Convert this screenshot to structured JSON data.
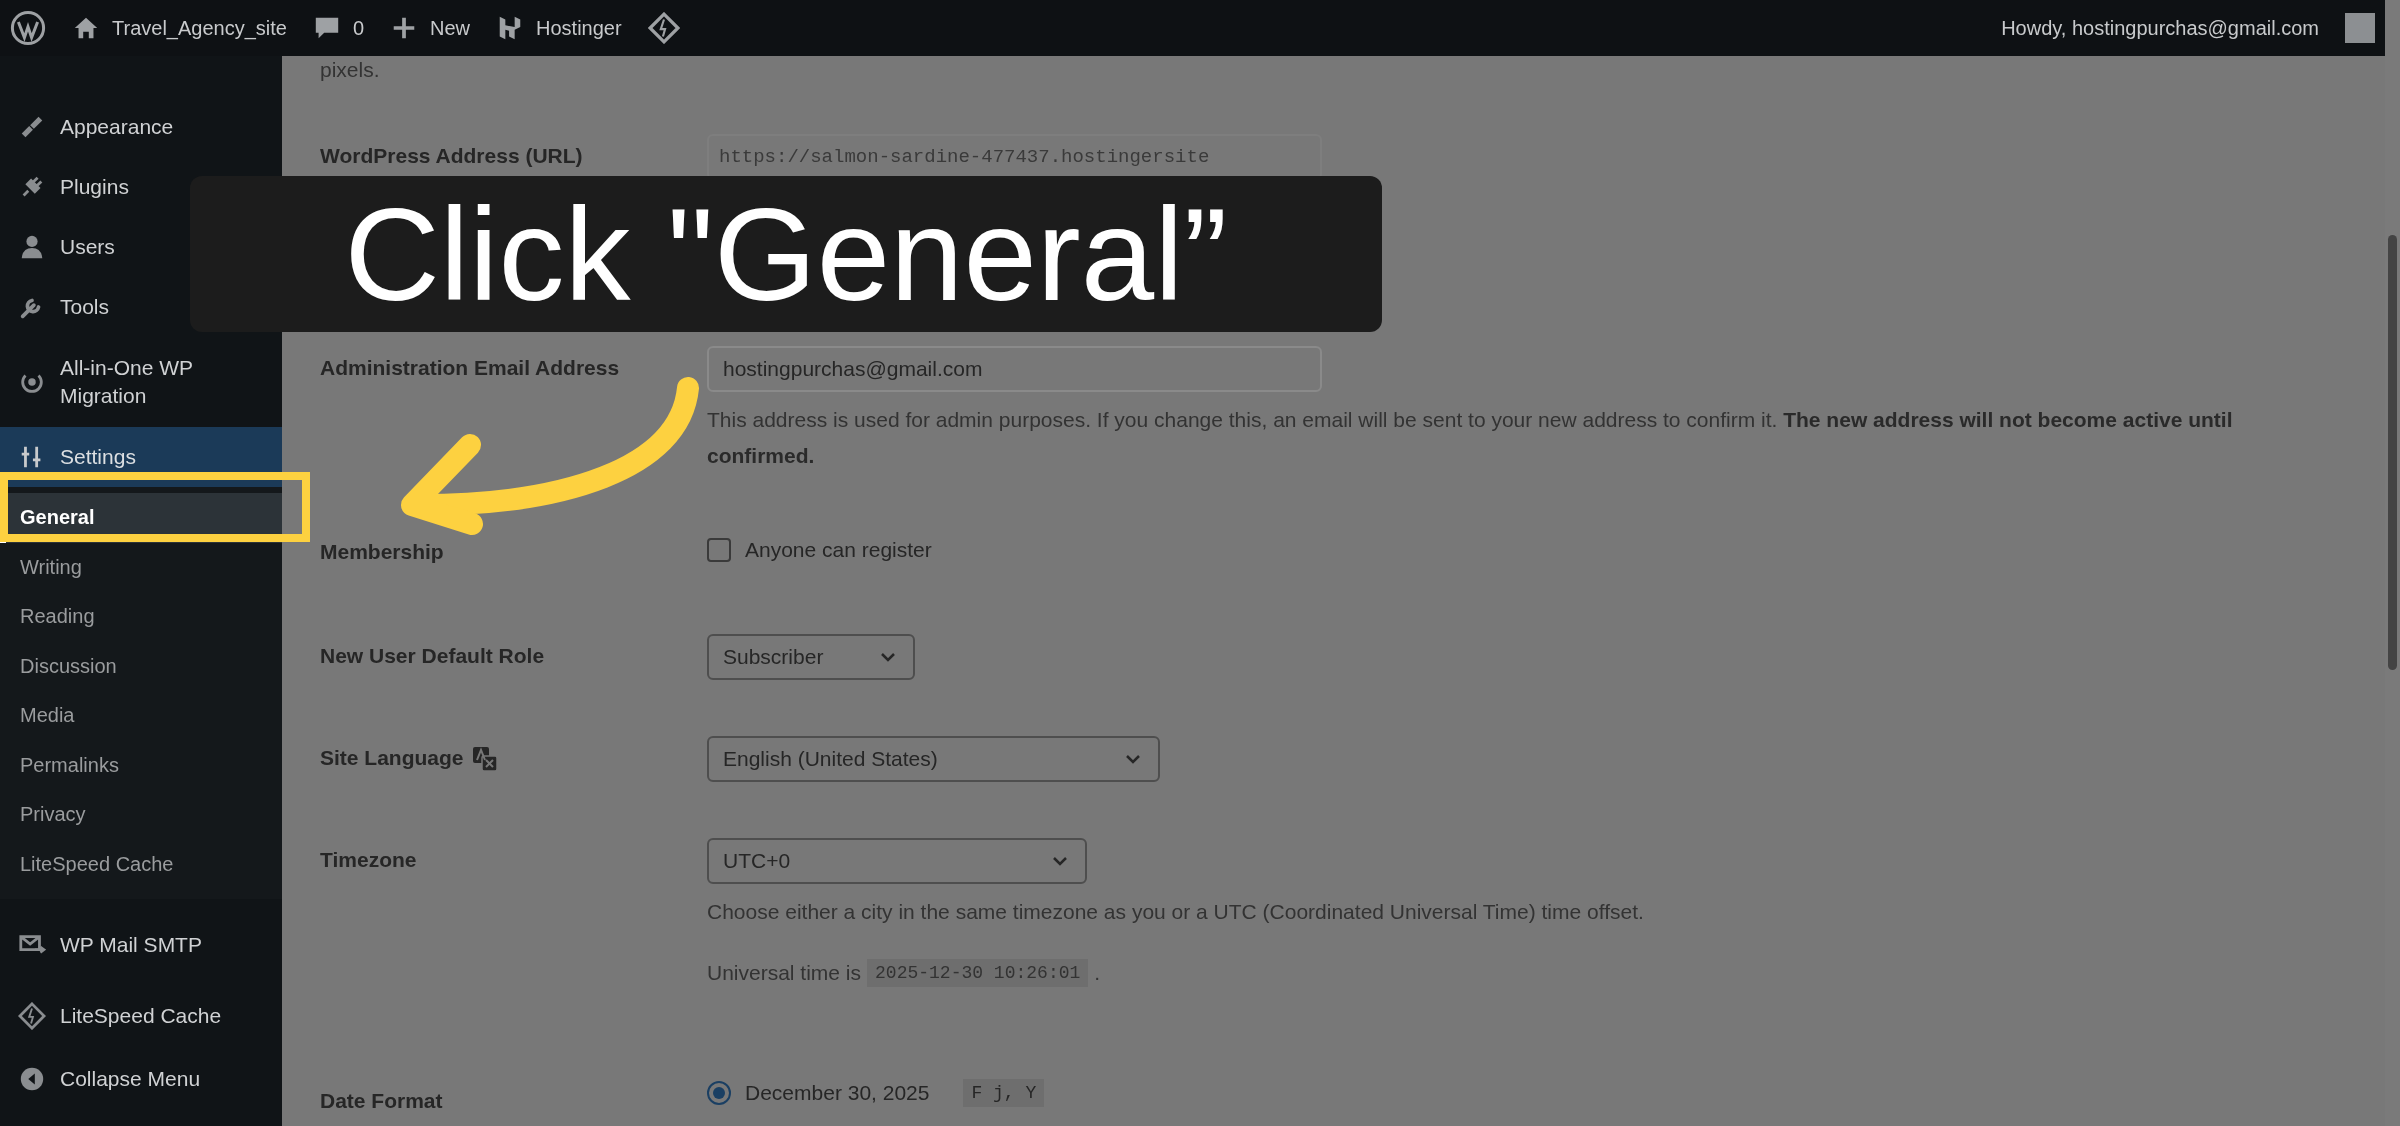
{
  "admin_bar": {
    "site_name": "Travel_Agency_site",
    "comments": "0",
    "new": "New",
    "hostinger": "Hostinger",
    "greeting": "Howdy, hostingpurchas@gmail.com"
  },
  "sidebar": {
    "items": [
      {
        "label": "Appearance",
        "selected": false
      },
      {
        "label": "Plugins",
        "selected": false
      },
      {
        "label": "Users",
        "selected": false
      },
      {
        "label": "Tools",
        "selected": false
      },
      {
        "label": "All-in-One WP Migration",
        "selected": false
      },
      {
        "label": "Settings",
        "selected": true,
        "children": [
          {
            "label": "General",
            "selected": true
          },
          {
            "label": "Writing",
            "selected": false
          },
          {
            "label": "Reading",
            "selected": false
          },
          {
            "label": "Discussion",
            "selected": false
          },
          {
            "label": "Media",
            "selected": false
          },
          {
            "label": "Permalinks",
            "selected": false
          },
          {
            "label": "Privacy",
            "selected": false
          },
          {
            "label": "LiteSpeed Cache",
            "selected": false
          }
        ]
      },
      {
        "label": "WP Mail SMTP",
        "selected": false
      },
      {
        "label": "LiteSpeed Cache",
        "selected": false
      },
      {
        "label": "Collapse Menu",
        "selected": false
      }
    ]
  },
  "settings_form": {
    "intro_tail": "pixels.",
    "rows": [
      {
        "kind": "url",
        "label": "WordPress Address (URL)",
        "value": "https://salmon-sardine-477437.hostingersite"
      },
      {
        "kind": "text",
        "label": "Administration Email Address",
        "value": "hostingpurchas@gmail.com",
        "description": "This address is used for admin purposes. If you change this, an email will be sent to your new address to confirm it. **The new address will not become active until confirmed.**"
      },
      {
        "kind": "checkbox",
        "label": "Membership",
        "option": "Anyone can register",
        "checked": false
      },
      {
        "kind": "select",
        "label": "New User Default Role",
        "value": "Subscriber"
      },
      {
        "kind": "select",
        "label": "Site Language",
        "value": "English (United States)",
        "label_icon": true
      },
      {
        "kind": "select",
        "label": "Timezone",
        "value": "UTC+0",
        "description": "Choose either a city in the same timezone as you or a UTC (Coordinated Universal Time) time offset.",
        "universal_time": {
          "label": "Universal time is",
          "value": "2025-12-30 10:26:01",
          "suffix": "."
        }
      },
      {
        "kind": "radio",
        "label": "Date Format",
        "options": [
          {
            "label": "December 30, 2025",
            "code": "F j, Y",
            "selected": true
          }
        ]
      }
    ]
  },
  "tutorial": {
    "callout": "Click \"General”",
    "highlight": true,
    "arrow": true
  }
}
